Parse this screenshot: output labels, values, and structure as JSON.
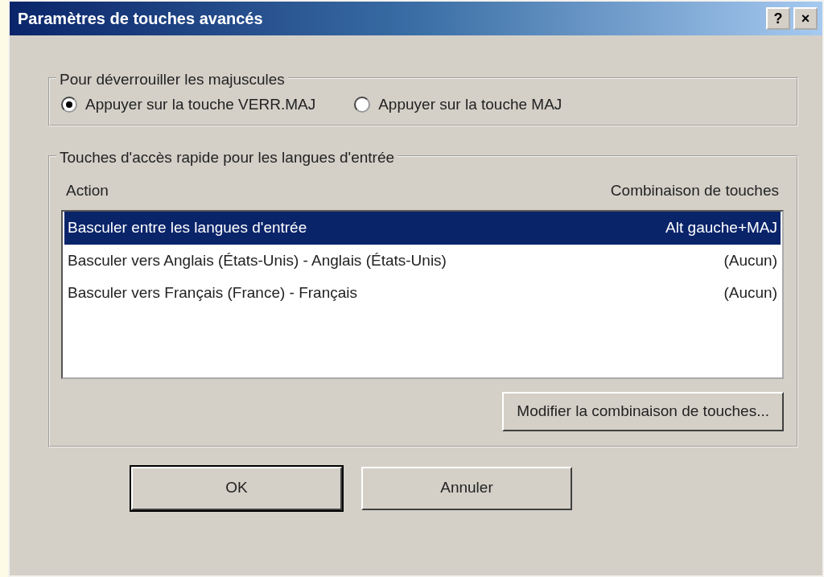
{
  "window": {
    "title": "Paramètres de touches avancés",
    "title_buttons": [
      "?",
      "×"
    ]
  },
  "caps_lock": {
    "label": "Pour déverrouiller les majuscules",
    "options": [
      {
        "label": "Appuyer sur la touche VERR.MAJ",
        "selected": true
      },
      {
        "label": "Appuyer sur la touche MAJ",
        "selected": false
      }
    ]
  },
  "hotkeys": {
    "label": "Touches d'accès rapide pour les langues d'entrée",
    "columns": [
      "Action",
      "Combinaison de touches"
    ],
    "rows": [
      {
        "action": "Basculer entre les langues d'entrée",
        "keys": "Alt gauche+MAJ",
        "selected": true
      },
      {
        "action": "Basculer vers Anglais (États-Unis) - Anglais (États-Unis)",
        "keys": "(Aucun)",
        "selected": false
      },
      {
        "action": "Basculer vers Français (France) - Français",
        "keys": "(Aucun)",
        "selected": false
      }
    ],
    "change_button": "Modifier la combinaison de touches..."
  },
  "buttons": [
    {
      "label": "OK",
      "default": true
    },
    {
      "label": "Annuler",
      "default": false
    }
  ]
}
